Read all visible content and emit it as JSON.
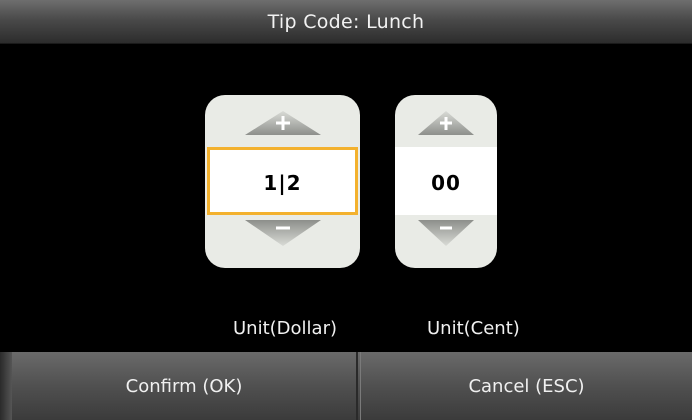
{
  "header": {
    "title": "Tip Code: Lunch"
  },
  "dollar": {
    "value": "1|2",
    "unit_label": "Unit(Dollar)"
  },
  "cent": {
    "value": "00",
    "unit_label": "Unit(Cent)"
  },
  "actions": {
    "confirm_label": "Confirm (OK)",
    "cancel_label": "Cancel (ESC)"
  },
  "colors": {
    "focus_border": "#f3b12e",
    "spinner_bg": "#e9ebe6"
  },
  "icons": {
    "increment": "plus-triangle-up-icon",
    "decrement": "minus-triangle-down-icon"
  }
}
